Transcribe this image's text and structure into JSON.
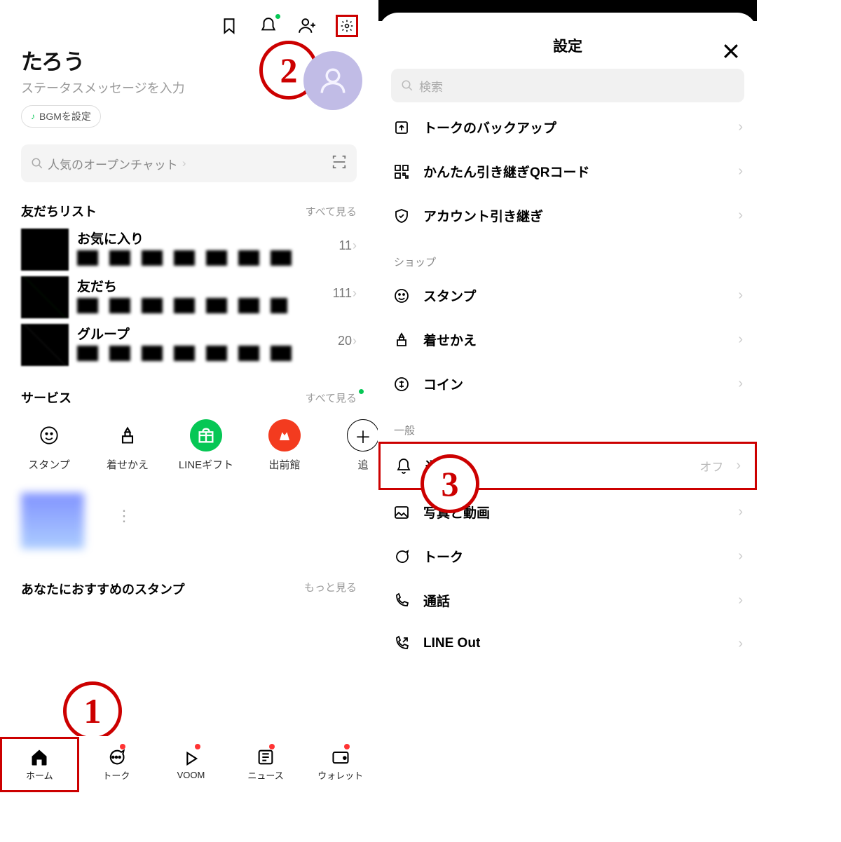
{
  "left": {
    "username": "たろう",
    "status_placeholder": "ステータスメッセージを入力",
    "bgm_label": "BGMを設定",
    "search_placeholder": "人気のオープンチャット",
    "friends_header": "友だちリスト",
    "see_all": "すべて見る",
    "friend_rows": [
      {
        "name": "お気に入り",
        "count": "11"
      },
      {
        "name": "友だち",
        "count": "111"
      },
      {
        "name": "グループ",
        "count": "20"
      }
    ],
    "services_header": "サービス",
    "services": [
      {
        "label": "スタンプ"
      },
      {
        "label": "着せかえ"
      },
      {
        "label": "LINEギフト"
      },
      {
        "label": "出前館"
      },
      {
        "label": "追"
      }
    ],
    "recommend": "あなたにおすすめのスタンプ",
    "more": "もっと見る",
    "tabs": [
      {
        "label": "ホーム"
      },
      {
        "label": "トーク"
      },
      {
        "label": "VOOM"
      },
      {
        "label": "ニュース"
      },
      {
        "label": "ウォレット"
      }
    ]
  },
  "right": {
    "title": "設定",
    "search_placeholder": "検索",
    "section_shop": "ショップ",
    "section_general": "一般",
    "rows_top": [
      {
        "label": "トークのバックアップ"
      },
      {
        "label": "かんたん引き継ぎQRコード"
      },
      {
        "label": "アカウント引き継ぎ"
      }
    ],
    "rows_shop": [
      {
        "label": "スタンプ"
      },
      {
        "label": "着せかえ"
      },
      {
        "label": "コイン"
      }
    ],
    "rows_general": [
      {
        "label": "通知",
        "value": "オフ"
      },
      {
        "label": "写真と動画"
      },
      {
        "label": "トーク"
      },
      {
        "label": "通話"
      },
      {
        "label": "LINE Out"
      }
    ]
  },
  "annotations": {
    "one": "1",
    "two": "2",
    "three": "3"
  }
}
